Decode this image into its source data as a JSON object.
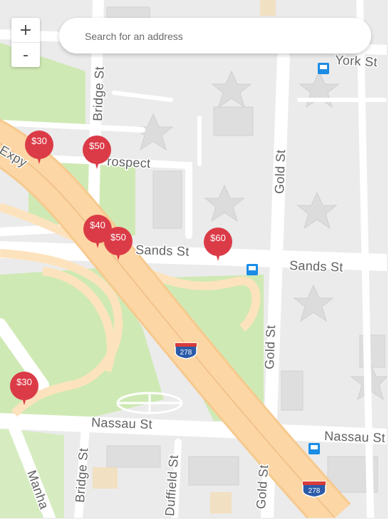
{
  "search": {
    "placeholder": "Search for an address",
    "value": ""
  },
  "zoom": {
    "in_label": "+",
    "out_label": "-"
  },
  "streets": {
    "york": "York St",
    "bridge_north": "Bridge St",
    "prospect_partial": "rospect",
    "expy_partial": "Expy",
    "gold_north": "Gold St",
    "sands_west": "Sands St",
    "sands_east": "Sands St",
    "gold_south": "Gold St",
    "nassau_west": "Nassau St",
    "nassau_east": "Nassau St",
    "bridge_south": "Bridge St",
    "duffield": "Duffield St",
    "gold_bottom": "Gold St",
    "manha_partial": "Manha"
  },
  "shields": {
    "i278_center": "278",
    "i278_bottom": "278"
  },
  "pins": [
    {
      "label": "$30"
    },
    {
      "label": "$50"
    },
    {
      "label": "$40"
    },
    {
      "label": "$50"
    },
    {
      "label": "$60"
    },
    {
      "label": "$30"
    }
  ],
  "colors": {
    "land": "#ebebeb",
    "park": "#cce8b0",
    "road": "#ffffff",
    "highway": "#fcd6a4",
    "pin": "#db3b47",
    "transit": "#1a8ce6"
  },
  "icons": [
    "bus-icon",
    "bus-icon",
    "bus-icon",
    "interstate-shield-icon"
  ]
}
